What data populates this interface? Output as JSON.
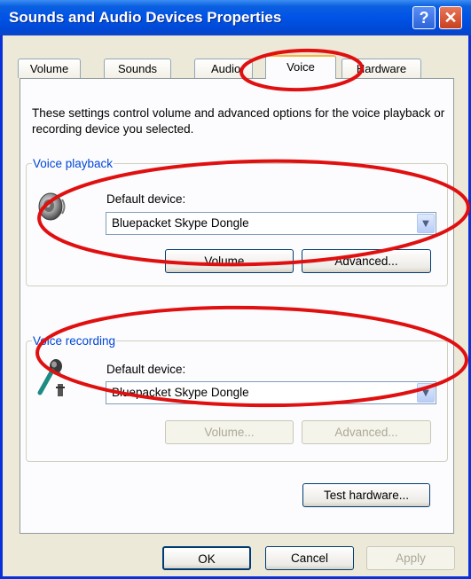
{
  "window": {
    "title": "Sounds and Audio Devices Properties",
    "help_glyph": "?",
    "close_glyph": "✕"
  },
  "tabs": [
    {
      "label": "Volume",
      "active": false
    },
    {
      "label": "Sounds",
      "active": false
    },
    {
      "label": "Audio",
      "active": false
    },
    {
      "label": "Voice",
      "active": true
    },
    {
      "label": "Hardware",
      "active": false
    }
  ],
  "voice_tab": {
    "intro": "These settings control volume and advanced options for the voice playback or recording device you selected.",
    "playback": {
      "legend": "Voice playback",
      "default_device_label": "Default device:",
      "device": "Bluepacket Skype Dongle",
      "volume_button": "Volume...",
      "advanced_button": "Advanced..."
    },
    "recording": {
      "legend": "Voice recording",
      "default_device_label": "Default device:",
      "device": "Bluepacket Skype Dongle",
      "volume_button": "Volume...",
      "advanced_button": "Advanced..."
    },
    "test_hardware_button": "Test hardware..."
  },
  "footer": {
    "ok": "OK",
    "cancel": "Cancel",
    "apply": "Apply"
  },
  "icons": {
    "playback": "speaker-icon",
    "recording": "microphone-icon",
    "dropdown": "chevron-down-icon"
  },
  "colors": {
    "title_bar": "#0053e6",
    "dialog_bg": "#ece9d8",
    "annotation": "#e01010"
  }
}
